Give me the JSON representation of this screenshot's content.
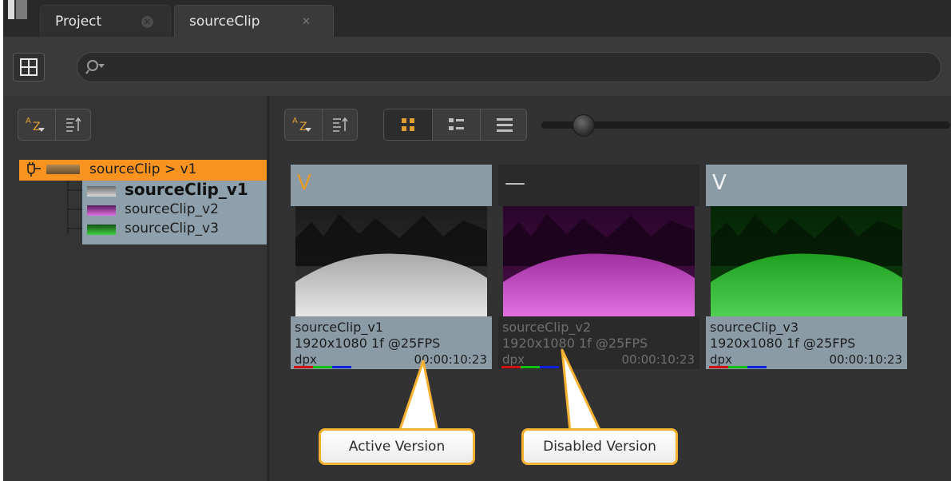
{
  "tabs": [
    {
      "label": "Project",
      "close": "✕"
    },
    {
      "label": "sourceClip",
      "close": "✕"
    }
  ],
  "search": {
    "placeholder": "",
    "value": ""
  },
  "tree": {
    "root_label": "sourceClip > v1",
    "items": [
      {
        "label": "sourceClip_v1",
        "active": true
      },
      {
        "label": "sourceClip_v2",
        "active": false
      },
      {
        "label": "sourceClip_v3",
        "active": false
      }
    ]
  },
  "sort": {
    "az_top": "A",
    "az_bottom": "Z"
  },
  "view": {
    "zoom_slider": 0.08
  },
  "versions": [
    {
      "mark": "V",
      "name": "sourceClip_v1",
      "info": "1920x1080  1f @25FPS",
      "format": "dpx",
      "timecode": "00:00:10:23",
      "state": "active"
    },
    {
      "mark": "—",
      "name": "sourceClip_v2",
      "info": "1920x1080  1f @25FPS",
      "format": "dpx",
      "timecode": "00:00:10:23",
      "state": "disabled"
    },
    {
      "mark": "V",
      "name": "sourceClip_v3",
      "info": "1920x1080  1f @25FPS",
      "format": "dpx",
      "timecode": "00:00:10:23",
      "state": "enabled"
    }
  ],
  "callouts": {
    "active": "Active Version",
    "disabled": "Disabled Version"
  },
  "colors": {
    "accent": "#f7931e",
    "selection": "#8b9ba6",
    "callout_border": "#f5b232"
  }
}
